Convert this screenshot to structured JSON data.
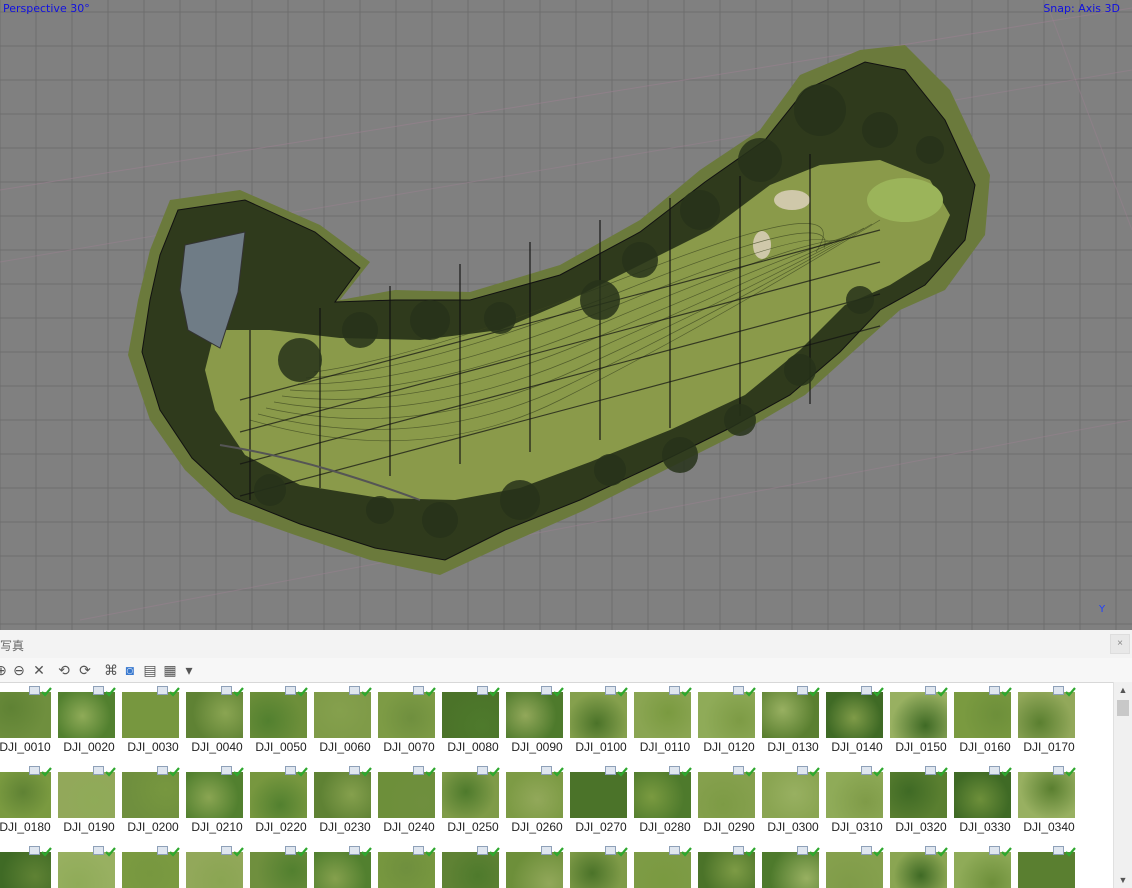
{
  "viewport": {
    "view_label": "Perspective 30°",
    "snap_label": "Snap: Axis 3D",
    "axis_label": "Y"
  },
  "panel": {
    "title": "写真",
    "close_glyph": "×"
  },
  "toolbar": {
    "icons": [
      "add-icon",
      "remove-icon",
      "delete-icon",
      "rotate-left-icon",
      "rotate-right-icon",
      "binoculars-icon",
      "camera-view-icon",
      "list-view-icon",
      "grid-view-icon",
      "dropdown-arrow-icon"
    ]
  },
  "photos": [
    "DJI_0010",
    "DJI_0020",
    "DJI_0030",
    "DJI_0040",
    "DJI_0050",
    "DJI_0060",
    "DJI_0070",
    "DJI_0080",
    "DJI_0090",
    "DJI_0100",
    "DJI_0110",
    "DJI_0120",
    "DJI_0130",
    "DJI_0140",
    "DJI_0150",
    "DJI_0160",
    "DJI_0170",
    "DJI_0180",
    "DJI_0190",
    "DJI_0200",
    "DJI_0210",
    "DJI_0220",
    "DJI_0230",
    "DJI_0240",
    "DJI_0250",
    "DJI_0260",
    "DJI_0270",
    "DJI_0280",
    "DJI_0290",
    "DJI_0300",
    "DJI_0310",
    "DJI_0320",
    "DJI_0330",
    "DJI_0340",
    "",
    "",
    "",
    "",
    "",
    "",
    "",
    "",
    "",
    "",
    "",
    "",
    "",
    "",
    "",
    "",
    ""
  ],
  "thumb_palette": [
    "#6f8f3e",
    "#7f9b48",
    "#8aa552",
    "#7a9a40",
    "#5f8234",
    "#4e7a2c",
    "#3f6a25",
    "#52802f",
    "#7d9b45",
    "#8fab58",
    "#92a85a",
    "#6d8f3a",
    "#85a04d",
    "#98b061",
    "#77973f",
    "#4b7329",
    "#5a7f30"
  ],
  "colors": {
    "viewport_bg": "#808080",
    "grid_line": "#6e6e6e",
    "terrain_fairway": "#8a9a4a",
    "terrain_forest": "#2f3a1c",
    "label_blue": "#1010e0",
    "check_green": "#2ea82e"
  }
}
